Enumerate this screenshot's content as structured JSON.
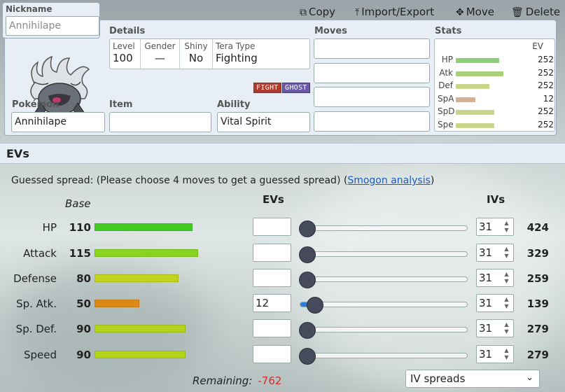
{
  "toolbar": {
    "copy": "Copy",
    "import_export": "Import/Export",
    "move": "Move",
    "delete": "Delete"
  },
  "nickname": {
    "label": "Nickname",
    "placeholder": "Annihilape"
  },
  "details": {
    "label": "Details",
    "level_label": "Level",
    "level": "100",
    "gender_label": "Gender",
    "gender": "—",
    "shiny_label": "Shiny",
    "shiny": "No",
    "tera_label": "Tera Type",
    "tera": "Fighting"
  },
  "types": [
    {
      "name": "FIGHT",
      "color": "#b33a2a"
    },
    {
      "name": "GHOST",
      "color": "#6a5aa8"
    }
  ],
  "pokemon": {
    "label": "Pokémon",
    "value": "Annihilape"
  },
  "item": {
    "label": "Item",
    "value": ""
  },
  "ability": {
    "label": "Ability",
    "value": "Vital Spirit"
  },
  "moves": {
    "label": "Moves",
    "values": [
      "",
      "",
      "",
      ""
    ]
  },
  "stats": {
    "label": "Stats",
    "ev_header": "EV",
    "rows": [
      {
        "name": "HP",
        "ev": "252",
        "fill": 0.56,
        "color": "#8fcf7a"
      },
      {
        "name": "Atk",
        "ev": "252",
        "fill": 0.62,
        "color": "#a8d27a"
      },
      {
        "name": "Def",
        "ev": "252",
        "fill": 0.44,
        "color": "#c8d58a"
      },
      {
        "name": "SpA",
        "ev": "12",
        "fill": 0.25,
        "color": "#d8b090"
      },
      {
        "name": "SpD",
        "ev": "252",
        "fill": 0.5,
        "color": "#c8d58a"
      },
      {
        "name": "Spe",
        "ev": "252",
        "fill": 0.5,
        "color": "#c8d58a"
      }
    ]
  },
  "evs": {
    "title": "EVs",
    "guessed_prefix": "Guessed spread: (Please choose 4 moves to get a guessed spread) (",
    "smogon_link": "Smogon analysis",
    "guessed_suffix": ")",
    "base_header": "Base",
    "evs_header": "EVs",
    "ivs_header": "IVs",
    "rows": [
      {
        "name": "HP",
        "base": "110",
        "base_fill": 0.55,
        "bar_color": "#44cc22",
        "ev": "",
        "ev_fill": 0.0,
        "iv": "31",
        "total": "424"
      },
      {
        "name": "Attack",
        "base": "115",
        "base_fill": 0.58,
        "bar_color": "#88d420",
        "ev": "",
        "ev_fill": 0.0,
        "iv": "31",
        "total": "329"
      },
      {
        "name": "Defense",
        "base": "80",
        "base_fill": 0.47,
        "bar_color": "#c4d41a",
        "ev": "",
        "ev_fill": 0.0,
        "iv": "31",
        "total": "259"
      },
      {
        "name": "Sp. Atk.",
        "base": "50",
        "base_fill": 0.25,
        "bar_color": "#dd8a15",
        "ev": "12",
        "ev_fill": 0.05,
        "iv": "31",
        "total": "139"
      },
      {
        "name": "Sp. Def.",
        "base": "90",
        "base_fill": 0.51,
        "bar_color": "#b4d41c",
        "ev": "",
        "ev_fill": 0.0,
        "iv": "31",
        "total": "279"
      },
      {
        "name": "Speed",
        "base": "90",
        "base_fill": 0.51,
        "bar_color": "#b4d41c",
        "ev": "",
        "ev_fill": 0.0,
        "iv": "31",
        "total": "279"
      }
    ],
    "remaining_label": "Remaining:",
    "remaining_value": "-762",
    "iv_spreads": "IV spreads"
  }
}
